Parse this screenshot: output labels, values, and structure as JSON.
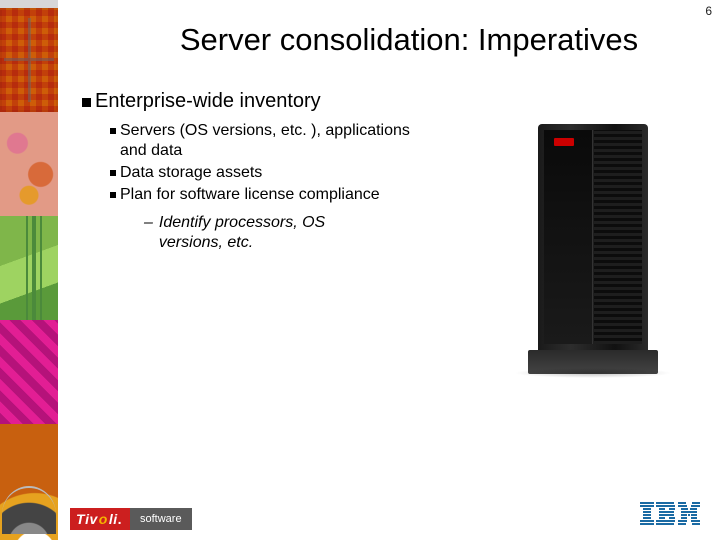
{
  "page_number": "6",
  "title": "Server consolidation: Imperatives",
  "content": {
    "heading": "Enterprise-wide inventory",
    "subitems": [
      "Servers (OS versions, etc. ), applications and data",
      "Data storage assets",
      "Plan for software license compliance"
    ],
    "dashitems": [
      "Identify processors, OS versions, etc."
    ]
  },
  "footer": {
    "brand_left_1": "Tivoli",
    "brand_left_2": "software",
    "brand_right": "IBM"
  }
}
